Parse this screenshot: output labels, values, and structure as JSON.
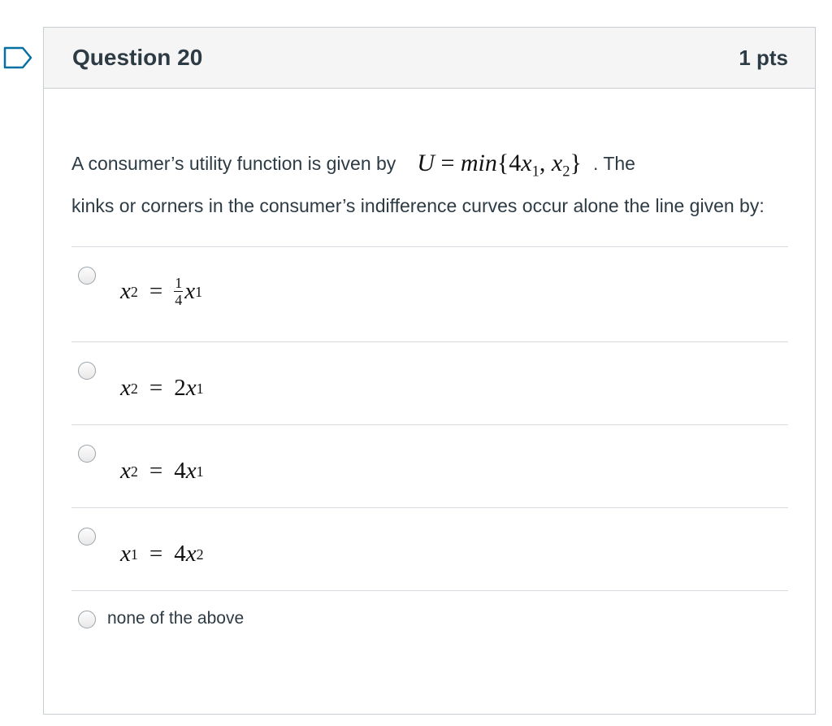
{
  "question": {
    "title": "Question 20",
    "points": "1 pts",
    "text_before": "A consumer’s utility function is given by",
    "text_after": ". The",
    "text_line2": "kinks or corners in the consumer’s indifference curves occur alone the line given by:"
  },
  "answers": [
    {
      "id": "a",
      "label": "x2 = (1/4)x1"
    },
    {
      "id": "b",
      "label": "x2 = 2x1"
    },
    {
      "id": "c",
      "label": "x2 = 4x1"
    },
    {
      "id": "d",
      "label": "x1 = 4x2"
    },
    {
      "id": "e",
      "label": "none of the above"
    }
  ],
  "colors": {
    "header_bg": "#f5f5f5",
    "border": "#c7cdd1",
    "text": "#2d3b45",
    "flag_outline": "#0770a3"
  }
}
